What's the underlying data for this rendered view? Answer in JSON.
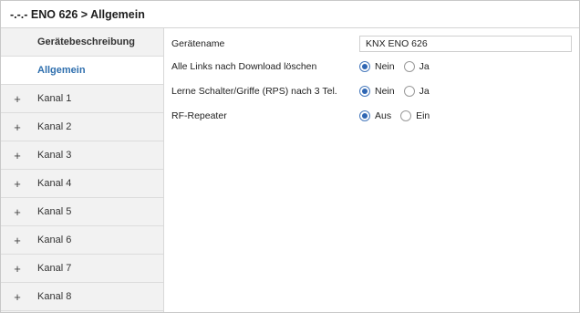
{
  "window": {
    "title": "-.-.- ENO 626 > Allgemein"
  },
  "sidebar": {
    "items": [
      {
        "label": "Gerätebeschreibung",
        "expandable": false,
        "active": false
      },
      {
        "label": "Allgemein",
        "expandable": false,
        "active": true
      },
      {
        "label": "Kanal 1",
        "expandable": true,
        "expand_glyph": "+"
      },
      {
        "label": "Kanal 2",
        "expandable": true,
        "expand_glyph": "+"
      },
      {
        "label": "Kanal 3",
        "expandable": true,
        "expand_glyph": "+"
      },
      {
        "label": "Kanal 4",
        "expandable": true,
        "expand_glyph": "+"
      },
      {
        "label": "Kanal 5",
        "expandable": true,
        "expand_glyph": "+"
      },
      {
        "label": "Kanal 6",
        "expandable": true,
        "expand_glyph": "+"
      },
      {
        "label": "Kanal 7",
        "expandable": true,
        "expand_glyph": "+"
      },
      {
        "label": "Kanal 8",
        "expandable": true,
        "expand_glyph": "+"
      }
    ]
  },
  "params": {
    "device_name": {
      "label": "Gerätename",
      "value": "KNX ENO 626"
    },
    "delete_links": {
      "label": "Alle Links nach Download löschen",
      "options": [
        "Nein",
        "Ja"
      ],
      "selected": "Nein"
    },
    "learn_switch": {
      "label": "Lerne Schalter/Griffe (RPS) nach 3 Tel.",
      "options": [
        "Nein",
        "Ja"
      ],
      "selected": "Nein"
    },
    "rf_repeater": {
      "label": "RF-Repeater",
      "options": [
        "Aus",
        "Ein"
      ],
      "selected": "Aus"
    }
  },
  "colors": {
    "accent": "#2f66b3",
    "active_text": "#2f6fae",
    "sidebar_bg": "#f2f2f2"
  }
}
